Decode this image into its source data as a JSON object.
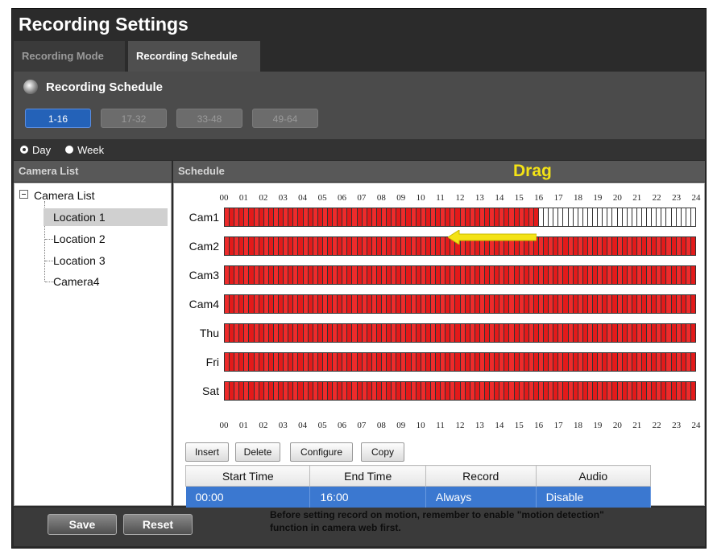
{
  "title": "Recording Settings",
  "tabs": [
    {
      "label": "Recording Mode",
      "active": false
    },
    {
      "label": "Recording Schedule",
      "active": true
    }
  ],
  "schedule_panel": {
    "heading": "Recording Schedule",
    "ranges": [
      {
        "label": "1-16",
        "active": true
      },
      {
        "label": "17-32",
        "active": false
      },
      {
        "label": "33-48",
        "active": false
      },
      {
        "label": "49-64",
        "active": false
      }
    ]
  },
  "mode": {
    "day_label": "Day",
    "week_label": "Week",
    "selected": "Day"
  },
  "camera_list": {
    "header": "Camera List",
    "root": "Camera List",
    "items": [
      "Location 1",
      "Location 2",
      "Location 3",
      "Camera4"
    ],
    "selected": "Location 1"
  },
  "schedule": {
    "header": "Schedule",
    "overlay_label": "Drag",
    "hours": [
      "00",
      "01",
      "02",
      "03",
      "04",
      "05",
      "06",
      "07",
      "08",
      "09",
      "10",
      "11",
      "12",
      "13",
      "14",
      "15",
      "16",
      "17",
      "18",
      "19",
      "20",
      "21",
      "22",
      "23",
      "24"
    ],
    "rows": [
      {
        "label": "Cam1",
        "recorded_until_hour": 16
      },
      {
        "label": "Cam2",
        "recorded_until_hour": 24
      },
      {
        "label": "Cam3",
        "recorded_until_hour": 24
      },
      {
        "label": "Cam4",
        "recorded_until_hour": 24
      },
      {
        "label": "Thu",
        "recorded_until_hour": 24
      },
      {
        "label": "Fri",
        "recorded_until_hour": 24
      },
      {
        "label": "Sat",
        "recorded_until_hour": 24
      }
    ],
    "arrow_color": "#f4e316",
    "fill_color": "#e31a1a"
  },
  "actions": {
    "insert": "Insert",
    "delete": "Delete",
    "configure": "Configure",
    "copy": "Copy"
  },
  "table": {
    "columns": [
      "Start Time",
      "End Time",
      "Record",
      "Audio"
    ],
    "rows": [
      [
        "00:00",
        "16:00",
        "Always",
        "Disable"
      ]
    ]
  },
  "footer": {
    "save": "Save",
    "reset": "Reset",
    "notice_line1": "Before setting record on motion, remember to enable \"motion detection\"",
    "notice_line2": "function in camera web first."
  }
}
